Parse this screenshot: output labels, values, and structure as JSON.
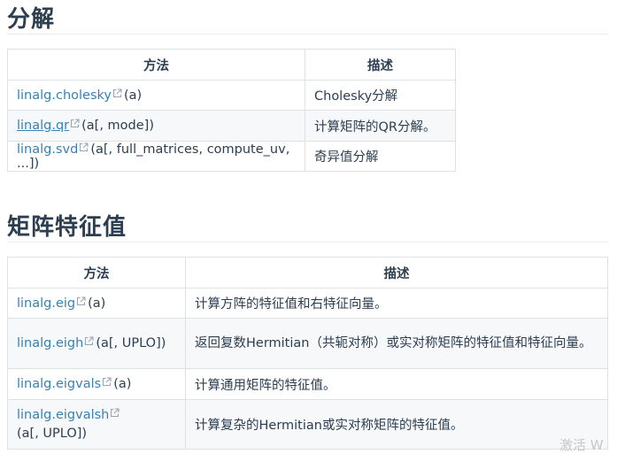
{
  "sections": [
    {
      "title": "分解",
      "headers": [
        "方法",
        "描述"
      ],
      "rows": [
        {
          "fn": "linalg.cholesky",
          "args": "(a)",
          "desc": "Cholesky分解"
        },
        {
          "fn": "linalg.qr",
          "args": "(a[, mode])",
          "desc": "计算矩阵的QR分解。"
        },
        {
          "fn": "linalg.svd",
          "args": "(a[, full_matrices, compute_uv, ...])",
          "desc": "奇异值分解"
        }
      ]
    },
    {
      "title": "矩阵特征值",
      "headers": [
        "方法",
        "描述"
      ],
      "rows": [
        {
          "fn": "linalg.eig",
          "args": "(a)",
          "desc": "计算方阵的特征值和右特征向量。"
        },
        {
          "fn": "linalg.eigh",
          "args": "(a[, UPLO])",
          "desc": "返回复数Hermitian（共轭对称）或实对称矩阵的特征值和特征向量。"
        },
        {
          "fn": "linalg.eigvals",
          "args": "(a)",
          "desc": "计算通用矩阵的特征值。"
        },
        {
          "fn": "linalg.eigvalsh",
          "args": "(a[, UPLO])",
          "desc": "计算复杂的Hermitian或实对称矩阵的特征值。"
        }
      ]
    }
  ],
  "watermark": "激活 W",
  "icons": {
    "external_link": "external-link-icon"
  },
  "colors": {
    "link": "#3a80b0",
    "text": "#2c3e50",
    "border": "#dfe2e5",
    "stripe": "#f6f8fa"
  }
}
